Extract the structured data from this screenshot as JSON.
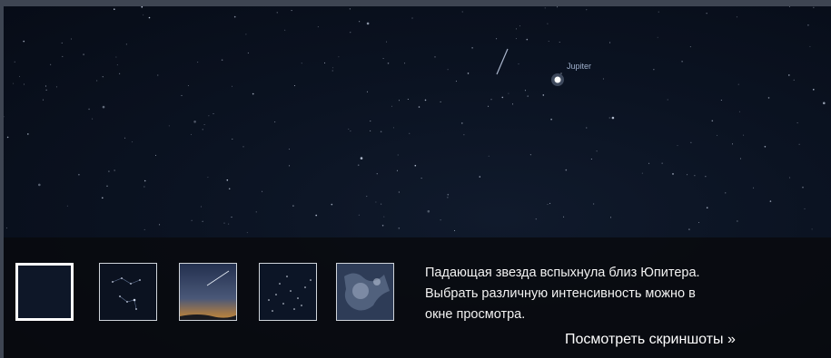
{
  "sky": {
    "planet_label": "Jupiter"
  },
  "gallery": {
    "thumbnails": [
      {
        "icon": "night-sky-dark-thumb",
        "active": true
      },
      {
        "icon": "constellation-thumb",
        "active": false
      },
      {
        "icon": "twilight-meteor-thumb",
        "active": false
      },
      {
        "icon": "star-field-thumb",
        "active": false
      },
      {
        "icon": "deep-sky-map-thumb",
        "active": false
      }
    ],
    "caption_lines": [
      "Падающая звезда вспыхнула близ Юпитера.",
      "Выбрать различную интенсивность можно в",
      "окне просмотра."
    ],
    "more_link": "Посмотреть скриншоты »"
  },
  "colors": {
    "frame": "#3e4552",
    "sky": "#0b1322",
    "bar": "#08090e",
    "text": "#f2f2f2"
  }
}
